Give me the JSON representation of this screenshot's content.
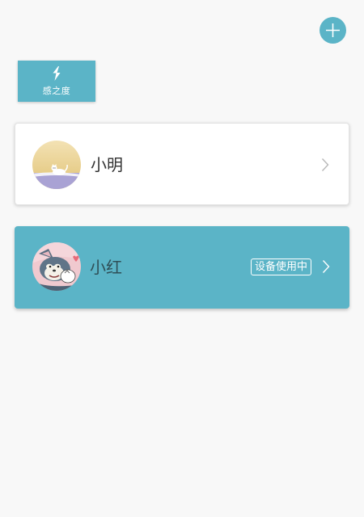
{
  "toolbar": {
    "add_icon": "plus-icon"
  },
  "brand": {
    "label": "感之度",
    "icon": "lightning-bolt-icon"
  },
  "colors": {
    "accent": "#5bb4c7",
    "background": "#f8f8f8",
    "card_white": "#ffffff"
  },
  "users": [
    {
      "name": "小明",
      "avatar": "cat-avatar-icon",
      "selected": false,
      "status": ""
    },
    {
      "name": "小红",
      "avatar": "tom-cat-avatar-icon",
      "selected": true,
      "status": "设备使用中"
    }
  ]
}
